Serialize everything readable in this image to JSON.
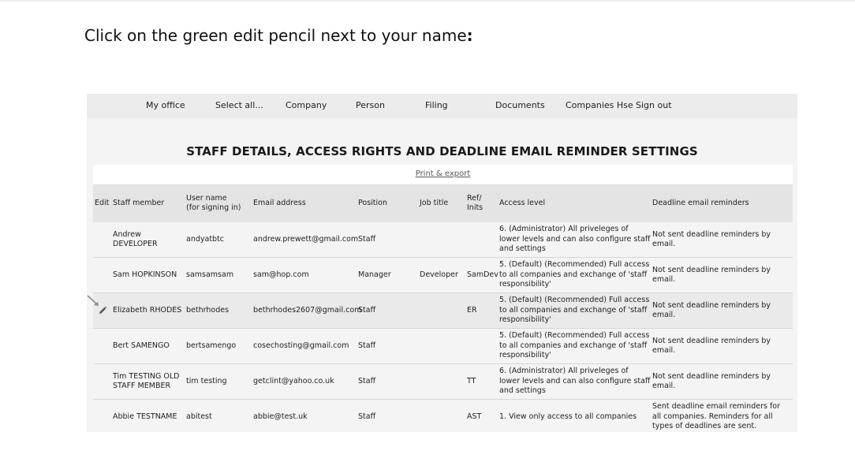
{
  "instruction": {
    "prefix": "Click on the green edit pencil next to your name",
    "suffix": ":"
  },
  "nav": {
    "items": [
      "My office",
      "Select all...",
      "Company",
      "Person",
      "Filing",
      "Documents",
      "Companies Hse",
      "Sign out"
    ]
  },
  "heading": "STAFF DETAILS, ACCESS RIGHTS AND DEADLINE EMAIL REMINDER SETTINGS",
  "print_export": "Print & export",
  "table": {
    "headers": {
      "edit": "Edit",
      "staff": "Staff member",
      "user_line1": "User name",
      "user_line2": "(for signing in)",
      "email": "Email address",
      "position": "Position",
      "job": "Job title",
      "ref_line1": "Ref/",
      "ref_line2": "Inits",
      "access": "Access level",
      "deadline": "Deadline email reminders"
    },
    "rows": [
      {
        "staff": "Andrew DEVELOPER",
        "user": "andyatbtc",
        "email": "andrew.prewett@gmail.com",
        "position": "Staff",
        "job": "",
        "ref": "",
        "access": "6. (Administrator) All priveleges of lower levels and can also configure staff and settings",
        "deadline": "Not sent deadline reminders by email."
      },
      {
        "staff": "Sam HOPKINSON",
        "user": "samsamsam",
        "email": "sam@hop.com",
        "position": "Manager",
        "job": "Developer",
        "ref": "SamDev",
        "access": "5. (Default) (Recommended) Full access to all companies and exchange of 'staff responsibility'",
        "deadline": "Not sent deadline reminders by email."
      },
      {
        "staff": "Elizabeth RHODES",
        "user": "bethrhodes",
        "email": "bethrhodes2607@gmail.com",
        "position": "Staff",
        "job": "",
        "ref": "ER",
        "access": "5. (Default) (Recommended) Full access to all companies and exchange of 'staff responsibility'",
        "deadline": "Not sent deadline reminders by email."
      },
      {
        "staff": "Bert SAMENGO",
        "user": "bertsamengo",
        "email": "cosechosting@gmail.com",
        "position": "Staff",
        "job": "",
        "ref": "",
        "access": "5. (Default) (Recommended) Full access to all companies and exchange of 'staff responsibility'",
        "deadline": "Not sent deadline reminders by email."
      },
      {
        "staff": "Tim TESTING OLD STAFF MEMBER",
        "user": "tim testing",
        "email": "getclint@yahoo.co.uk",
        "position": "Staff",
        "job": "",
        "ref": "TT",
        "access": "6. (Administrator) All priveleges of lower levels and can also configure staff and settings",
        "deadline": "Not sent deadline reminders by email."
      },
      {
        "staff": "Abbie TESTNAME",
        "user": "abitest",
        "email": "abbie@test.uk",
        "position": "Staff",
        "job": "",
        "ref": "AST",
        "access": "1. View only access to all companies",
        "deadline": "Sent deadline email reminders for all companies. Reminders for all types of deadlines are sent."
      }
    ]
  },
  "colors": {
    "nav_bg": "#ececec",
    "frame_bg": "#f4f4f4",
    "header_bg": "#e4e4e4",
    "highlight_bg": "#eaeaea",
    "pencil": "#555555",
    "arrow": "#8a8a8a"
  },
  "icons": {
    "edit": "pencil-icon",
    "pointer": "arrow-icon"
  }
}
